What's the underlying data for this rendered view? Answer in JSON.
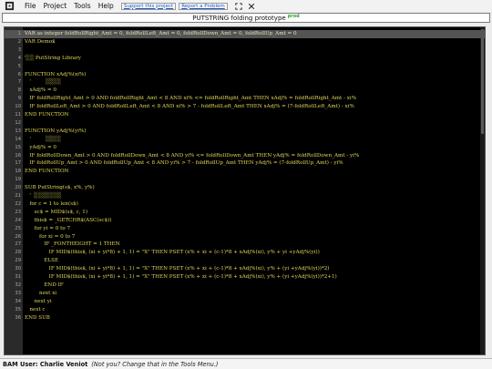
{
  "menubar": {
    "items": [
      "File",
      "Project",
      "Tools",
      "Help"
    ],
    "support_link": "Support this project",
    "report_link": "Report a Problem"
  },
  "titlebar": {
    "title": "PUTSTRING folding prototype",
    "badge": "prod"
  },
  "editor": {
    "lines": [
      {
        "n": "1",
        "code": "VAR as integer foldRollRight_Amt = 0, foldRollLeft_Amt = 0, foldRollDown_Amt = 0, foldRollUp_Amt = 0"
      },
      {
        "n": "2",
        "code": "VAR Demo$"
      },
      {
        "n": "3",
        "code": ""
      },
      {
        "n": "4",
        "code": "'░░ PutString Library"
      },
      {
        "n": "5",
        "code": ""
      },
      {
        "n": "6",
        "code": "FUNCTION xAdj%(xi%)"
      },
      {
        "n": "7",
        "code": "   '         ░░░░"
      },
      {
        "n": "8",
        "code": "   xAdj% = 0"
      },
      {
        "n": "9",
        "code": "   IF foldRollRight_Amt > 0 AND foldRollRight_Amt < 8 AND xi% <= foldRollRight_Amt THEN xAdj% = foldRollRight_Amt - xi%"
      },
      {
        "n": "10",
        "code": "   IF foldRollLeft_Amt > 0 AND foldRollLeft_Amt < 8 AND xi% > 7 - foldRollLeft_Amt THEN xAdj% = (7-foldRollLeft_Amt) - xi%"
      },
      {
        "n": "11",
        "code": "END FUNCTION"
      },
      {
        "n": "12",
        "code": ""
      },
      {
        "n": "13",
        "code": "FUNCTION yAdj%(yi%)"
      },
      {
        "n": "14",
        "code": "   '         ░░░░"
      },
      {
        "n": "15",
        "code": "   yAdj% = 0"
      },
      {
        "n": "16",
        "code": "   IF foldRollDown_Amt > 0 AND foldRollDown_Amt < 8 AND yi% <= foldRollDown_Amt THEN yAdj% = foldRollDown_Amt - yi%"
      },
      {
        "n": "17",
        "code": "   IF foldRollUp_Amt > 0 AND foldRollUp_Amt < 8 AND yi% > 7 - foldRollUp_Amt THEN yAdj% = (7-foldRollUp_Amt) - yi%"
      },
      {
        "n": "18",
        "code": "END FUNCTION"
      },
      {
        "n": "19",
        "code": ""
      },
      {
        "n": "20",
        "code": "SUB PutString(s$, x%, y%)"
      },
      {
        "n": "21",
        "code": "   '  ░░░░░░░"
      },
      {
        "n": "22",
        "code": "   for c = 1 to len(s$)"
      },
      {
        "n": "23",
        "code": "      sc$ = MID$(s$, c, 1)"
      },
      {
        "n": "24",
        "code": "      this$ = _GETCHR$(ASC(sc$))"
      },
      {
        "n": "25",
        "code": "      for yi = 0 to 7"
      },
      {
        "n": "26",
        "code": "         for xi = 0 to 7"
      },
      {
        "n": "27",
        "code": "            IF _FONTHEIGHT = 1 THEN"
      },
      {
        "n": "28",
        "code": "               IF MID$(this$, (xi + yi*8) + 1, 1) = \"X\" THEN PSET (x% + xi + (c-1)*8 + xAdj%(xi), y% + yi +yAdj%(yi))"
      },
      {
        "n": "29",
        "code": "            ELSE"
      },
      {
        "n": "30",
        "code": "               IF MID$(this$, (xi + yi*8) + 1, 1) = \"X\" THEN PSET (x% + xi + (c-1)*8 + xAdj%(xi), y% + (yi +yAdj%(yi))*2)"
      },
      {
        "n": "31",
        "code": "               IF MID$(this$, (xi + yi*8) + 1, 1) = \"X\" THEN PSET (x% + xi + (c-1)*8 + xAdj%(xi), y% + (yi +yAdj%(yi))*2+1)"
      },
      {
        "n": "32",
        "code": "            END IF"
      },
      {
        "n": "33",
        "code": "         next xi"
      },
      {
        "n": "34",
        "code": "      next yi"
      },
      {
        "n": "35",
        "code": "   next c"
      },
      {
        "n": "36",
        "code": "END SUB"
      }
    ]
  },
  "statusbar": {
    "user_label": "BAM User: Charlie Veniot",
    "hint": "(Not you? Change that in the Tools Menu.)"
  },
  "colors": {
    "code_text": "#e2d85a",
    "background": "#000000",
    "current_line": "#545454",
    "badge": "#2e9e2e",
    "link": "#1a56c4"
  }
}
